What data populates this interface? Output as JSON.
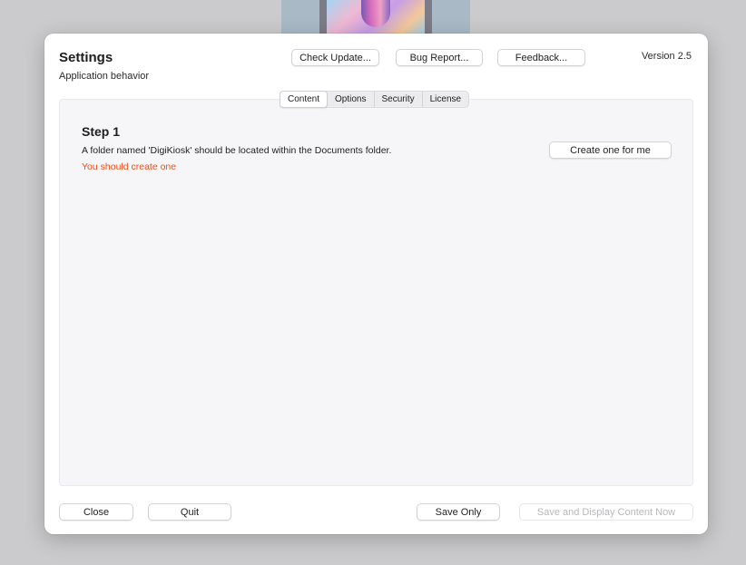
{
  "window": {
    "title": "Settings",
    "subtitle": "Application behavior",
    "version": "Version 2.5"
  },
  "toolbar": {
    "check_update": "Check Update...",
    "bug_report": "Bug Report...",
    "feedback": "Feedback..."
  },
  "tabs": [
    {
      "label": "Content",
      "active": true
    },
    {
      "label": "Options",
      "active": false
    },
    {
      "label": "Security",
      "active": false
    },
    {
      "label": "License",
      "active": false
    }
  ],
  "content": {
    "step_title": "Step 1",
    "description": "A folder named 'DigiKiosk' should be located within the Documents folder.",
    "warning": "You should create one",
    "create_button": "Create one for me",
    "warning_color": "#e8501e"
  },
  "footer": {
    "close": "Close",
    "quit": "Quit",
    "save_only": "Save Only",
    "save_display": "Save and Display Content Now",
    "save_display_enabled": false
  }
}
